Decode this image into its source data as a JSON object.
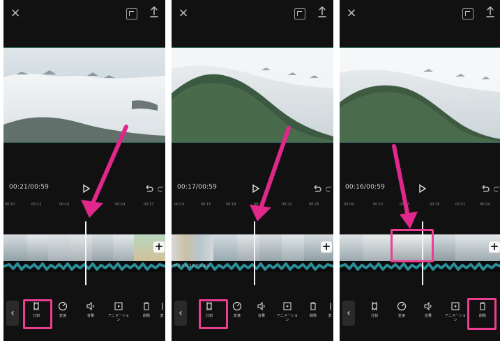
{
  "panels": [
    {
      "timecode": "00:21/00:59",
      "ticks": [
        "00:10",
        "00:12",
        "00:16",
        "00:18",
        "00:24",
        "00:27"
      ],
      "tools": {
        "split": "分割",
        "speed": "変速",
        "volume": "音量",
        "animation": "アニメーション",
        "delete": "削除",
        "more": "変"
      }
    },
    {
      "timecode": "00:17/00:59",
      "ticks": [
        "00:14",
        "00:15",
        "00:18",
        "00:20",
        "00:22",
        "00:25"
      ],
      "audio_label": "サウンドコレクション",
      "tools": {
        "split": "分割",
        "speed": "変速",
        "volume": "音量",
        "animation": "アニメーション",
        "delete": "削除",
        "more": "変"
      }
    },
    {
      "timecode": "00:16/00:59",
      "ticks": [
        "00:09",
        "00:12",
        "00:15",
        "00:16",
        "00:21",
        "00:24"
      ],
      "tools": {
        "split": "分割",
        "speed": "変速",
        "volume": "音量",
        "animation": "アニメーション",
        "delete": "削除"
      }
    }
  ],
  "colors": {
    "background": "#111111",
    "accent_pink": "#ec3d91",
    "audio_teal": "#2b8d97",
    "text": "#d7d7d7"
  }
}
